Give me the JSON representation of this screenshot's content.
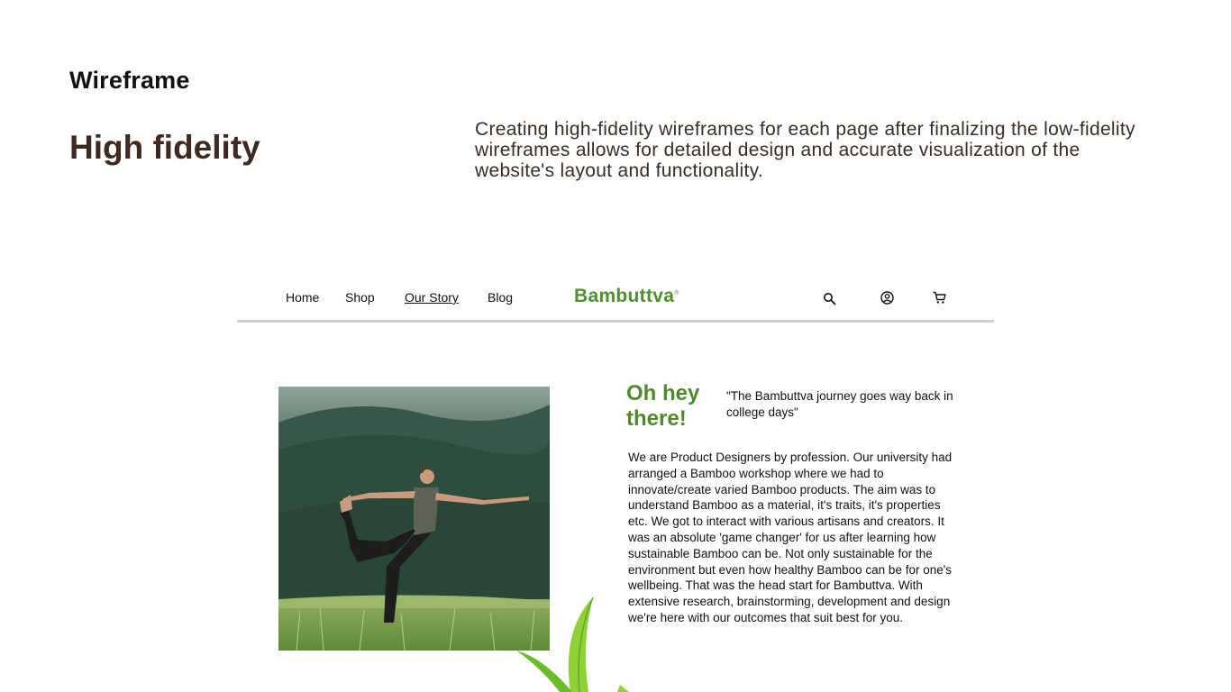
{
  "page": {
    "section_label": "Wireframe",
    "heading": "High fidelity",
    "description": "Creating high-fidelity wireframes for each page after finalizing the low-fidelity wireframes allows for detailed design and accurate visualization of the website's layout and functionality."
  },
  "mockup": {
    "nav": {
      "home": "Home",
      "shop": "Shop",
      "our_story": "Our Story",
      "blog": "Blog",
      "logo": "Bambuttva",
      "logo_mark": "®",
      "icons": [
        "search-icon",
        "user-icon",
        "cart-icon"
      ]
    },
    "content": {
      "greeting": "Oh hey there!",
      "quote": "\"The Bambuttva journey goes way back in college days\"",
      "body": "We are Product Designers by profession. Our university had arranged a Bamboo workshop where we had to innovate/create varied Bamboo products. The aim was to understand Bamboo as a material, it's traits, it's properties etc. We got to interact with various artisans and creators. It was an absolute 'game changer' for us after learning how sustainable Bamboo can be. Not only sustainable for the environment but even how healthy Bamboo can be for one's wellbeing. That was the head start for Bambuttva. With extensive research, brainstorming, development and design we're here with our outcomes that suit best for you."
    }
  },
  "colors": {
    "heading": "#3e2a20",
    "brand_green": "#4f8f2e",
    "greeting_green": "#4f8a2d",
    "divider": "#d0d0d0"
  }
}
